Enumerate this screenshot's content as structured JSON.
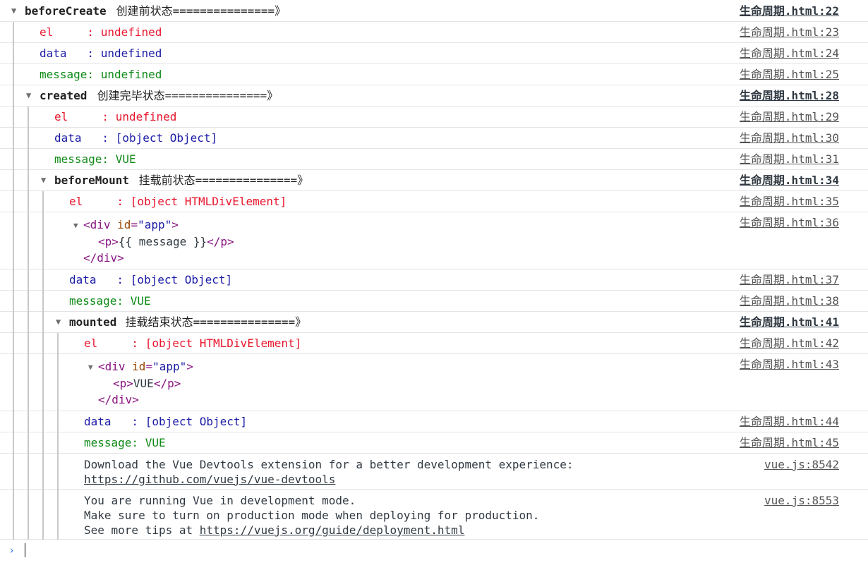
{
  "groups": [
    {
      "label": "beforeCreate",
      "desc": " 创建前状态===============》",
      "source": "生命周期.html:22"
    },
    {
      "label": "created",
      "desc": " 创建完毕状态===============》",
      "source": "生命周期.html:28"
    },
    {
      "label": "beforeMount",
      "desc": " 挂载前状态===============》",
      "source": "生命周期.html:34"
    },
    {
      "label": "mounted",
      "desc": " 挂载结束状态===============》",
      "source": "生命周期.html:41"
    }
  ],
  "logs": [
    {
      "text": "el     : undefined",
      "source": "生命周期.html:23"
    },
    {
      "text": "data   : undefined",
      "source": "生命周期.html:24"
    },
    {
      "text": "message: undefined",
      "source": "生命周期.html:25"
    },
    {
      "text": "el     : undefined",
      "source": "生命周期.html:29"
    },
    {
      "text": "data   : [object Object]",
      "source": "生命周期.html:30"
    },
    {
      "text": "message: VUE",
      "source": "生命周期.html:31"
    },
    {
      "text": "el     : [object HTMLDivElement]",
      "source": "生命周期.html:35"
    },
    {
      "text": "",
      "source": "生命周期.html:36"
    },
    {
      "text": "data   : [object Object]",
      "source": "生命周期.html:37"
    },
    {
      "text": "message: VUE",
      "source": "生命周期.html:38"
    },
    {
      "text": "el     : [object HTMLDivElement]",
      "source": "生命周期.html:42"
    },
    {
      "text": "",
      "source": "生命周期.html:43"
    },
    {
      "text": "data   : [object Object]",
      "source": "生命周期.html:44"
    },
    {
      "text": "message: VUE",
      "source": "生命周期.html:45"
    }
  ],
  "dom_nodes": [
    {
      "open": "<div",
      "attr": "id",
      "eq": "=",
      "val": "\"app\"",
      "close": ">",
      "p_open": "<p>",
      "p_text": "{{ message }}",
      "p_close": "</p>",
      "end": "</div>"
    },
    {
      "open": "<div",
      "attr": "id",
      "eq": "=",
      "val": "\"app\"",
      "close": ">",
      "p_open": "<p>",
      "p_text": "VUE",
      "p_close": "</p>",
      "end": "</div>"
    }
  ],
  "vue_messages": [
    {
      "line1": "Download the Vue Devtools extension for a better development experience:",
      "link": "https://github.com/vuejs/vue-devtools",
      "source": "vue.js:8542"
    },
    {
      "line1": "You are running Vue in development mode.",
      "line2": "Make sure to turn on production mode when deploying for production.",
      "line3_prefix": "See more tips at ",
      "link": "https://vuejs.org/guide/deployment.html",
      "source": "vue.js:8553"
    }
  ],
  "prompt": {
    "symbol": "›"
  },
  "colors": {
    "el": "#e8152c",
    "data": "#1a1aa6",
    "message": "#0e8a16",
    "prompt": "#367cf1"
  }
}
